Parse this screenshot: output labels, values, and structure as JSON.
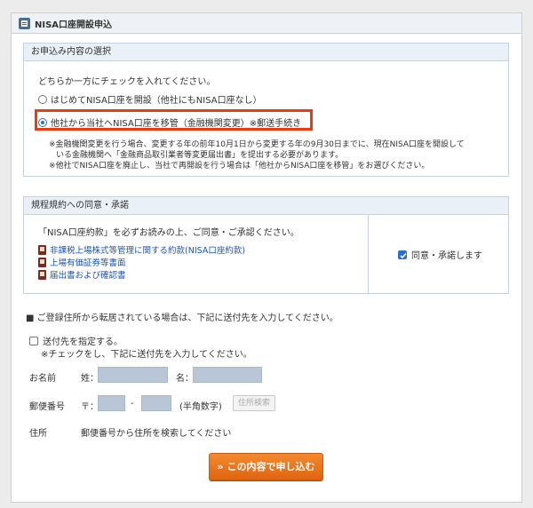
{
  "header": {
    "title": "NISA口座開設申込"
  },
  "selection": {
    "heading": "お申込み内容の選択",
    "instruction": "どちらか一方にチェックを入れてください。",
    "option1": "はじめてNISA口座を開設（他社にもNISA口座なし）",
    "option2": "他社から当社へNISA口座を移管（金融機関変更）※郵送手続き",
    "note1": "※金融機関変更を行う場合、変更する年の前年10月1日から変更する年の9月30日までに、現在NISA口座を開設して",
    "note2": "いる金融機関へ「金融商品取引業者等変更届出書」を提出する必要があります。",
    "note3": "※他社でNISA口座を廃止し、当社で再開設を行う場合は「他社からNISA口座を移管」をお選びください。"
  },
  "agreement": {
    "heading": "規程規約への同意・承諾",
    "instruction": "「NISA口座約款」を必ずお読みの上、ご同意・ご承認ください。",
    "links": [
      "非課税上場株式等管理に関する約款(NISA口座約款)",
      "上場有価証券等書面",
      "届出書および確認書"
    ],
    "consent_label": "同意・承諾します"
  },
  "shipping": {
    "notice": "■ ご登録住所から転居されている場合は、下記に送付先を入力してください。",
    "checkbox_label": "送付先を指定する。",
    "checkbox_sub": "※チェックをし、下記に送付先を入力してください。",
    "name_label": "お名前",
    "surname_label": "姓：",
    "given_label": "名：",
    "postal_label": "郵便番号",
    "postal_mark": "〒：",
    "postal_dash": "-",
    "postal_hint": "(半角数字)",
    "postal_search": "住所検索",
    "address_label": "住所",
    "address_hint": "郵便番号から住所を検索してください"
  },
  "submit_label": "» この内容で申し込む"
}
